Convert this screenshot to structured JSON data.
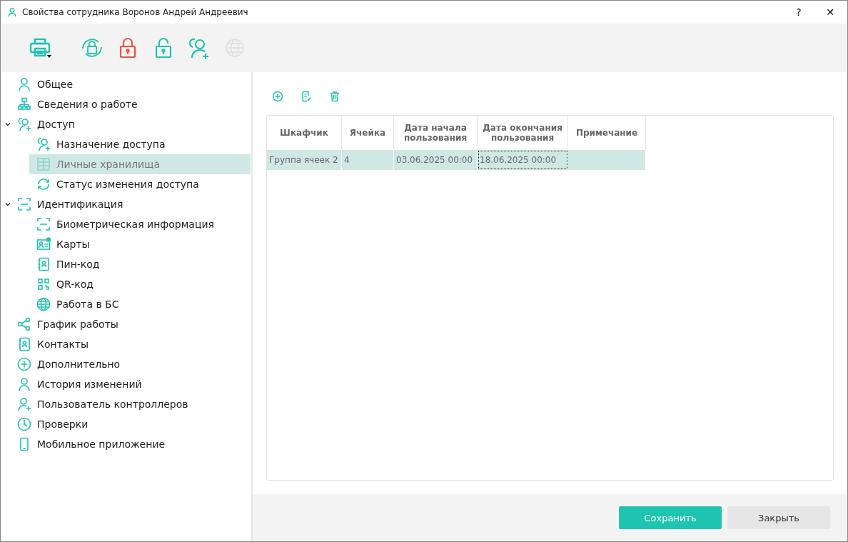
{
  "window": {
    "title": "Свойства сотрудника Воронов Андрей Андреевич",
    "help": "?",
    "close": "✕"
  },
  "toolbar": [
    {
      "disabled": false
    },
    {
      "disabled": false
    },
    {
      "disabled": false
    },
    {
      "disabled": false
    },
    {
      "disabled": false
    },
    {
      "disabled": true
    }
  ],
  "sidebar": {
    "items": [
      {
        "label": "Общее",
        "selected": false
      },
      {
        "label": "Сведения о работе",
        "selected": false
      },
      {
        "label": "Доступ",
        "selected": false,
        "expanded": true,
        "children": [
          {
            "label": "Назначение доступа",
            "selected": false
          },
          {
            "label": "Личные хранилища",
            "selected": true
          },
          {
            "label": "Статус изменения доступа",
            "selected": false
          }
        ]
      },
      {
        "label": "Идентификация",
        "selected": false,
        "expanded": true,
        "children": [
          {
            "label": "Биометрическая информация",
            "selected": false
          },
          {
            "label": "Карты",
            "selected": false
          },
          {
            "label": "Пин-код",
            "selected": false
          },
          {
            "label": "QR-код",
            "selected": false
          },
          {
            "label": "Работа в БС",
            "selected": false
          }
        ]
      },
      {
        "label": "График работы",
        "selected": false
      },
      {
        "label": "Контакты",
        "selected": false
      },
      {
        "label": "Дополнительно",
        "selected": false
      },
      {
        "label": "История изменений",
        "selected": false
      },
      {
        "label": "Пользователь контроллеров",
        "selected": false
      },
      {
        "label": "Проверки",
        "selected": false
      },
      {
        "label": "Мобильное приложение",
        "selected": false
      }
    ]
  },
  "table": {
    "columns": [
      "Шкафчик",
      "Ячейка",
      "Дата начала пользования",
      "Дата окончания пользования",
      "Примечание"
    ],
    "rows": [
      {
        "selected": true,
        "cells": [
          {
            "text": "Группа ячеек 2",
            "focused": false
          },
          {
            "text": "4",
            "focused": false
          },
          {
            "text": "03.06.2025 00:00",
            "focused": false
          },
          {
            "text": "18.06.2025 00:00",
            "focused": true
          },
          {
            "text": "",
            "focused": false
          }
        ]
      }
    ]
  },
  "buttons": [
    {
      "label": "Сохранить",
      "kind": "primary"
    },
    {
      "label": "Закрыть",
      "kind": "secondary"
    }
  ]
}
